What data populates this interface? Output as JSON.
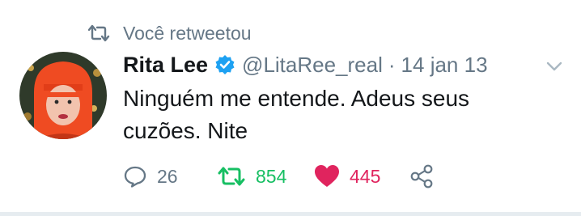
{
  "context": {
    "text": "Você retweetou",
    "icon": "retweet-icon"
  },
  "tweet": {
    "author_name": "Rita Lee",
    "verified": true,
    "handle": "@LitaRee_real",
    "separator": "·",
    "date": "14 jan 13",
    "text": "Ninguém me entende. Adeus seus cuzões. Nite"
  },
  "actions": {
    "reply_count": "26",
    "retweet_count": "854",
    "like_count": "445",
    "retweeted": true,
    "liked": true
  },
  "colors": {
    "secondary": "#657786",
    "retweet_green": "#17bf63",
    "like_red": "#e0245e",
    "verified_blue": "#1da1f2"
  }
}
